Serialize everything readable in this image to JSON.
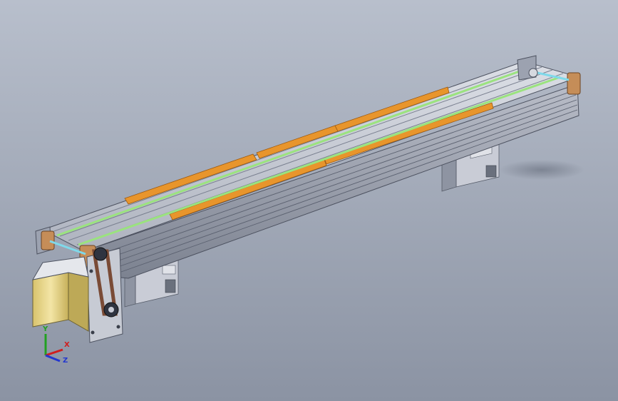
{
  "viewport": {
    "background_top": "#b8bfcc",
    "background_bottom": "#8b93a3"
  },
  "model": {
    "parts": [
      "aluminum-profile-frame",
      "conveyor-belt-green",
      "guide-strip-orange",
      "end-bracket",
      "support-leg",
      "stepper-motor",
      "motor-mount-plate",
      "drive-belt",
      "pulley"
    ],
    "colors": {
      "frame_light": "#cfd3dc",
      "frame_mid": "#a7acb8",
      "frame_dark": "#6d7382",
      "belt": "#9be37f",
      "guide_strip": "#e8952c",
      "bracket_wood": "#c58d58",
      "motor_body": "#e9d68a",
      "drive_belt": "#7a4b36"
    }
  },
  "triad": {
    "x_label": "X",
    "y_label": "Y",
    "z_label": "Z",
    "x_color": "#d01e1e",
    "y_color": "#21a121",
    "z_color": "#2337cf"
  }
}
